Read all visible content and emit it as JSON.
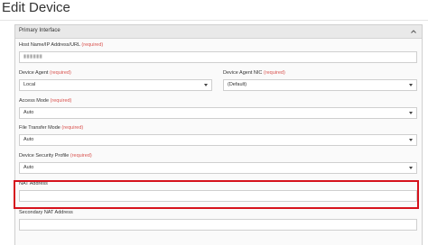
{
  "page": {
    "title": "Edit Device"
  },
  "panel": {
    "title": "Primary Interface"
  },
  "fields": {
    "host": {
      "label": "Host Name/IP Address/URL",
      "required": "(required)",
      "value": "▮▮▮▮▮▮"
    },
    "device_agent": {
      "label": "Device Agent",
      "required": "(required)",
      "value": "Local"
    },
    "device_agent_nic": {
      "label": "Device Agent NIC",
      "required": "(required)",
      "value": "(Default)"
    },
    "access_mode": {
      "label": "Access Mode",
      "required": "(required)",
      "value": "Auto"
    },
    "file_transfer_mode": {
      "label": "File Transfer Mode",
      "required": "(required)",
      "value": "Auto"
    },
    "device_security_profile": {
      "label": "Device Security Profile",
      "required": "(required)",
      "value": "Auto"
    },
    "nat_address": {
      "label": "NAT Address",
      "value": ""
    },
    "secondary_nat_address": {
      "label": "Secondary NAT Address",
      "value": ""
    }
  },
  "colors": {
    "required": "#d9534f",
    "highlight": "#d6121c"
  },
  "icons": {
    "collapse": "chevron-up-icon",
    "select": "caret-down-icon"
  }
}
